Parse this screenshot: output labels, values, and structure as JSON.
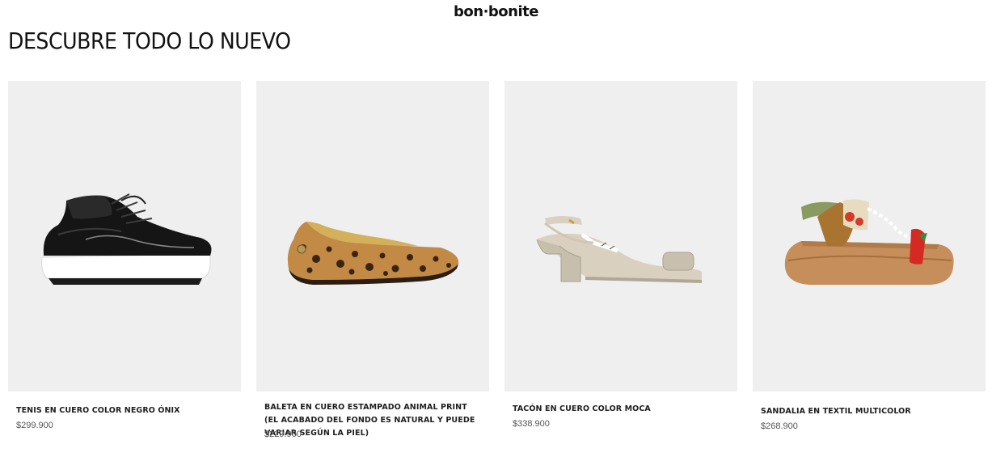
{
  "brand": {
    "logo_text": "bon·bonite"
  },
  "page": {
    "title": "DESCUBRE TODO LO NUEVO"
  },
  "products": [
    {
      "name": "TENIS EN CUERO COLOR NEGRO ÓNIX",
      "price": "$299.900",
      "image_icon": "black-leather-sneaker"
    },
    {
      "name": "BALETA EN CUERO ESTAMPADO ANIMAL PRINT (EL ACABADO DEL FONDO ES NATURAL Y PUEDE VARIAR SEGÚN LA PIEL)",
      "price": "$229.900",
      "image_icon": "leopard-print-flat"
    },
    {
      "name": "TACÓN EN CUERO COLOR MOCA",
      "price": "$338.900",
      "image_icon": "beige-slingback-heel"
    },
    {
      "name": "SANDALIA EN TEXTIL MULTICOLOR",
      "price": "$268.900",
      "image_icon": "multicolor-platform-sandal"
    }
  ],
  "colors": {
    "card_background": "#efeff0",
    "text": "#1e1e1e",
    "price_text": "#555555"
  }
}
